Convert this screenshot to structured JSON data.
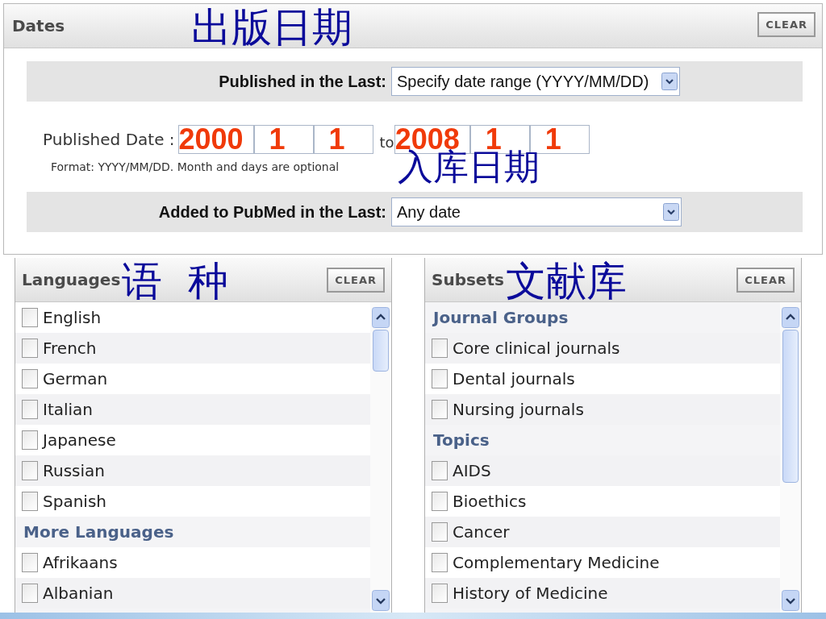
{
  "dates": {
    "title": "Dates",
    "annotation": "出版日期",
    "clear": "CLEAR",
    "published_in_last": {
      "label": "Published in the Last:",
      "value": "Specify date range (YYYY/MM/DD)"
    },
    "published_date": {
      "label": "Published Date :",
      "from": [
        "2000",
        "1",
        "1"
      ],
      "to_label": "to",
      "to": [
        "2008",
        "1",
        "1"
      ],
      "format": "Format: YYYY/MM/DD. Month and days are optional",
      "annotation": "入库日期"
    },
    "added_in_last": {
      "label": "Added to PubMed in the Last:",
      "value": "Any date"
    }
  },
  "panels": [
    {
      "title": "Languages",
      "annotation": "语  种",
      "clear": "CLEAR",
      "items": [
        {
          "kind": "option",
          "label": "English",
          "checked": false
        },
        {
          "kind": "option",
          "label": "French",
          "checked": false
        },
        {
          "kind": "option",
          "label": "German",
          "checked": false
        },
        {
          "kind": "option",
          "label": "Italian",
          "checked": false
        },
        {
          "kind": "option",
          "label": "Japanese",
          "checked": false
        },
        {
          "kind": "option",
          "label": "Russian",
          "checked": false
        },
        {
          "kind": "option",
          "label": "Spanish",
          "checked": false
        },
        {
          "kind": "group",
          "label": "More Languages"
        },
        {
          "kind": "option",
          "label": "Afrikaans",
          "checked": false
        },
        {
          "kind": "option",
          "label": "Albanian",
          "checked": false
        }
      ]
    },
    {
      "title": "Subsets",
      "annotation": "文献库",
      "clear": "CLEAR",
      "items": [
        {
          "kind": "group",
          "label": "Journal Groups"
        },
        {
          "kind": "option",
          "label": "Core clinical journals",
          "checked": false
        },
        {
          "kind": "option",
          "label": "Dental journals",
          "checked": false
        },
        {
          "kind": "option",
          "label": "Nursing journals",
          "checked": false
        },
        {
          "kind": "group",
          "label": "Topics"
        },
        {
          "kind": "option",
          "label": "AIDS",
          "checked": false
        },
        {
          "kind": "option",
          "label": "Bioethics",
          "checked": false
        },
        {
          "kind": "option",
          "label": "Cancer",
          "checked": false
        },
        {
          "kind": "option",
          "label": "Complementary Medicine",
          "checked": false
        },
        {
          "kind": "option",
          "label": "History of Medicine",
          "checked": false
        }
      ]
    }
  ]
}
